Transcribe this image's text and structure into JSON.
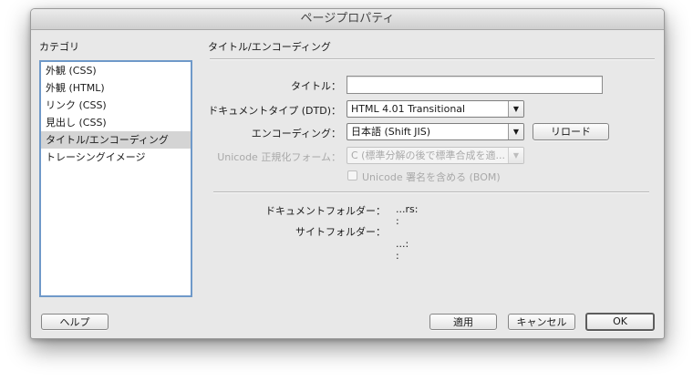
{
  "window": {
    "title": "ページプロパティ"
  },
  "categories": {
    "label": "カテゴリ",
    "items": [
      {
        "label": "外観 (CSS)"
      },
      {
        "label": "外観 (HTML)"
      },
      {
        "label": "リンク (CSS)"
      },
      {
        "label": "見出し (CSS)"
      },
      {
        "label": "タイトル/エンコーディング",
        "selected": true
      },
      {
        "label": "トレーシングイメージ"
      }
    ]
  },
  "section": {
    "title": "タイトル/エンコーディング"
  },
  "form": {
    "title_label": "タイトル：",
    "title_value": "",
    "doctype_label": "ドキュメントタイプ (DTD)：",
    "doctype_value": "HTML 4.01 Transitional",
    "encoding_label": "エンコーディング：",
    "encoding_value": "日本語 (Shift JIS)",
    "reload_label": "リロード",
    "unicode_label": "Unicode 正規化フォーム：",
    "unicode_value": "C (標準分解の後で標準合成を適...",
    "bom_label": "Unicode 署名を含める (BOM)"
  },
  "info": {
    "doc_folder_label": "ドキュメントフォルダー：",
    "doc_folder_value1": "...rs:",
    "doc_folder_value2": ":",
    "site_folder_label": "サイトフォルダー：",
    "site_folder_value1": "...:",
    "site_folder_value2": ":"
  },
  "buttons": {
    "help": "ヘルプ",
    "apply": "適用",
    "cancel": "キャンセル",
    "ok": "OK"
  }
}
